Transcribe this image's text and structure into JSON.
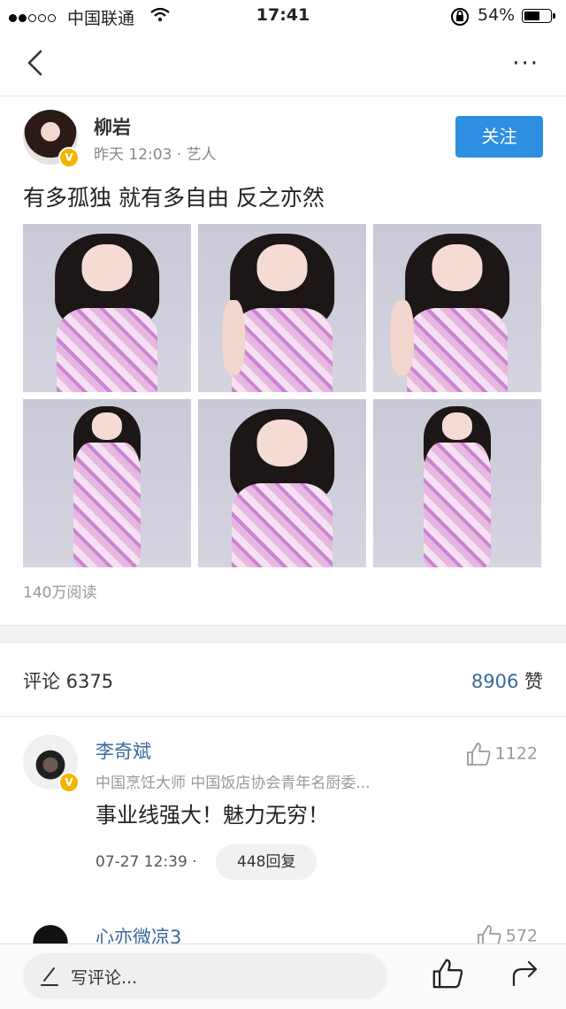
{
  "status": {
    "carrier": "中国联通",
    "time": "17:41",
    "battery": "54%",
    "battery_level": 0.54
  },
  "nav": {
    "back_icon": "chevron-left-icon",
    "more_label": "···"
  },
  "post": {
    "author": "柳岩",
    "meta": "昨天 12:03 · 艺人",
    "follow_label": "关注",
    "verified_badge": "V",
    "text": "有多孤独 就有多自由 反之亦然",
    "reads": "140万阅读",
    "photos": [
      "p1",
      "p2",
      "p3",
      "p4",
      "p5",
      "p6"
    ]
  },
  "counts": {
    "comments_label": "评论 6375",
    "likes_number": "8906",
    "likes_suffix": "赞"
  },
  "comments": [
    {
      "name": "李奇斌",
      "title": "中国烹饪大师 中国饭店协会青年名厨委...",
      "text": "事业线强大！魅力无穷！",
      "time": "07-27 12:39 ·",
      "replies": "448回复",
      "likes": "1122"
    },
    {
      "name": "心亦微凉3",
      "likes": "572"
    }
  ],
  "bottom": {
    "input_placeholder": "写评论...",
    "like_icon": "thumbs-up-icon",
    "share_icon": "share-icon"
  },
  "colors": {
    "accent": "#2e8ee2",
    "link": "#3a6a9a",
    "badge": "#f5b400"
  }
}
